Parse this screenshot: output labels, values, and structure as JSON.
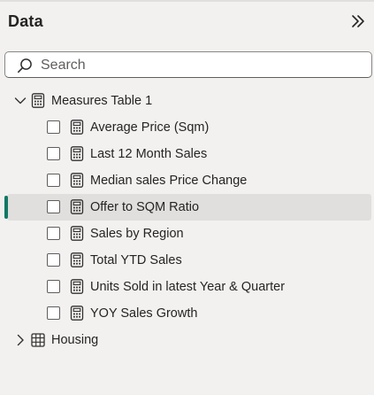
{
  "pane": {
    "title": "Data",
    "collapse_icon": "double-chevron-right-icon"
  },
  "search": {
    "placeholder": "Search",
    "value": ""
  },
  "tree": {
    "measures_table": {
      "label": "Measures Table 1",
      "expanded": true,
      "icon": "calculator-table-icon",
      "items": [
        {
          "label": "Average Price (Sqm)",
          "checked": false,
          "icon": "calculator-icon"
        },
        {
          "label": "Last 12 Month Sales",
          "checked": false,
          "icon": "calculator-icon"
        },
        {
          "label": "Median sales Price Change",
          "checked": false,
          "icon": "calculator-icon"
        },
        {
          "label": "Offer to SQM Ratio",
          "checked": false,
          "icon": "calculator-icon",
          "selected": true
        },
        {
          "label": "Sales by Region",
          "checked": false,
          "icon": "calculator-icon"
        },
        {
          "label": "Total YTD Sales",
          "checked": false,
          "icon": "calculator-icon"
        },
        {
          "label": "Units Sold in latest Year & Quarter",
          "checked": false,
          "icon": "calculator-icon"
        },
        {
          "label": "YOY Sales Growth",
          "checked": false,
          "icon": "calculator-icon"
        }
      ]
    },
    "housing_table": {
      "label": "Housing",
      "expanded": false,
      "icon": "table-grid-icon"
    }
  },
  "colors": {
    "accent": "#117865",
    "background": "#f2f1f0",
    "selected_row": "#e1dfdd"
  }
}
